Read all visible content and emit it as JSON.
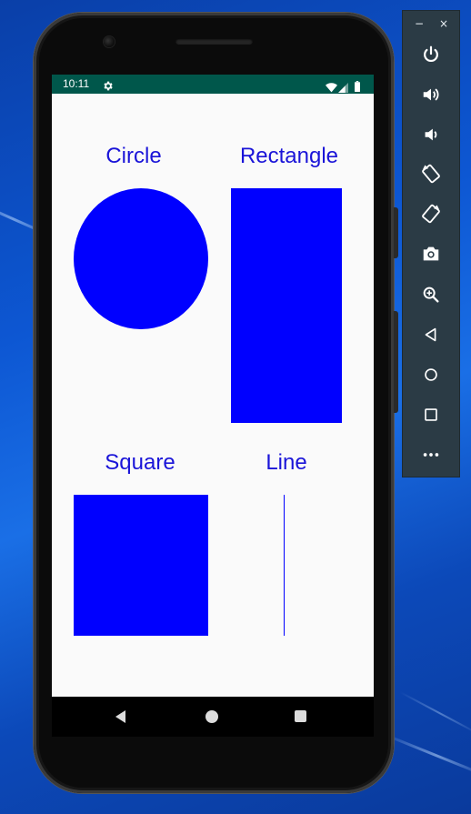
{
  "status_bar": {
    "time": "10:11",
    "icons": [
      "settings-icon",
      "wifi-icon",
      "signal-icon",
      "battery-icon"
    ],
    "background": "#00574b"
  },
  "shapes": {
    "color": "#0000ff",
    "label_color": "#1a14d8",
    "circle_label": "Circle",
    "rectangle_label": "Rectangle",
    "square_label": "Square",
    "line_label": "Line"
  },
  "nav_bar": {
    "buttons": [
      "back-icon",
      "home-icon",
      "recents-icon"
    ]
  },
  "emulator_toolbar": {
    "minimize": "−",
    "close": "×",
    "tools": [
      "power-icon",
      "volume-up-icon",
      "volume-down-icon",
      "rotate-left-icon",
      "rotate-right-icon",
      "camera-icon",
      "zoom-icon",
      "back-icon",
      "home-icon",
      "overview-icon",
      "more-icon"
    ]
  }
}
